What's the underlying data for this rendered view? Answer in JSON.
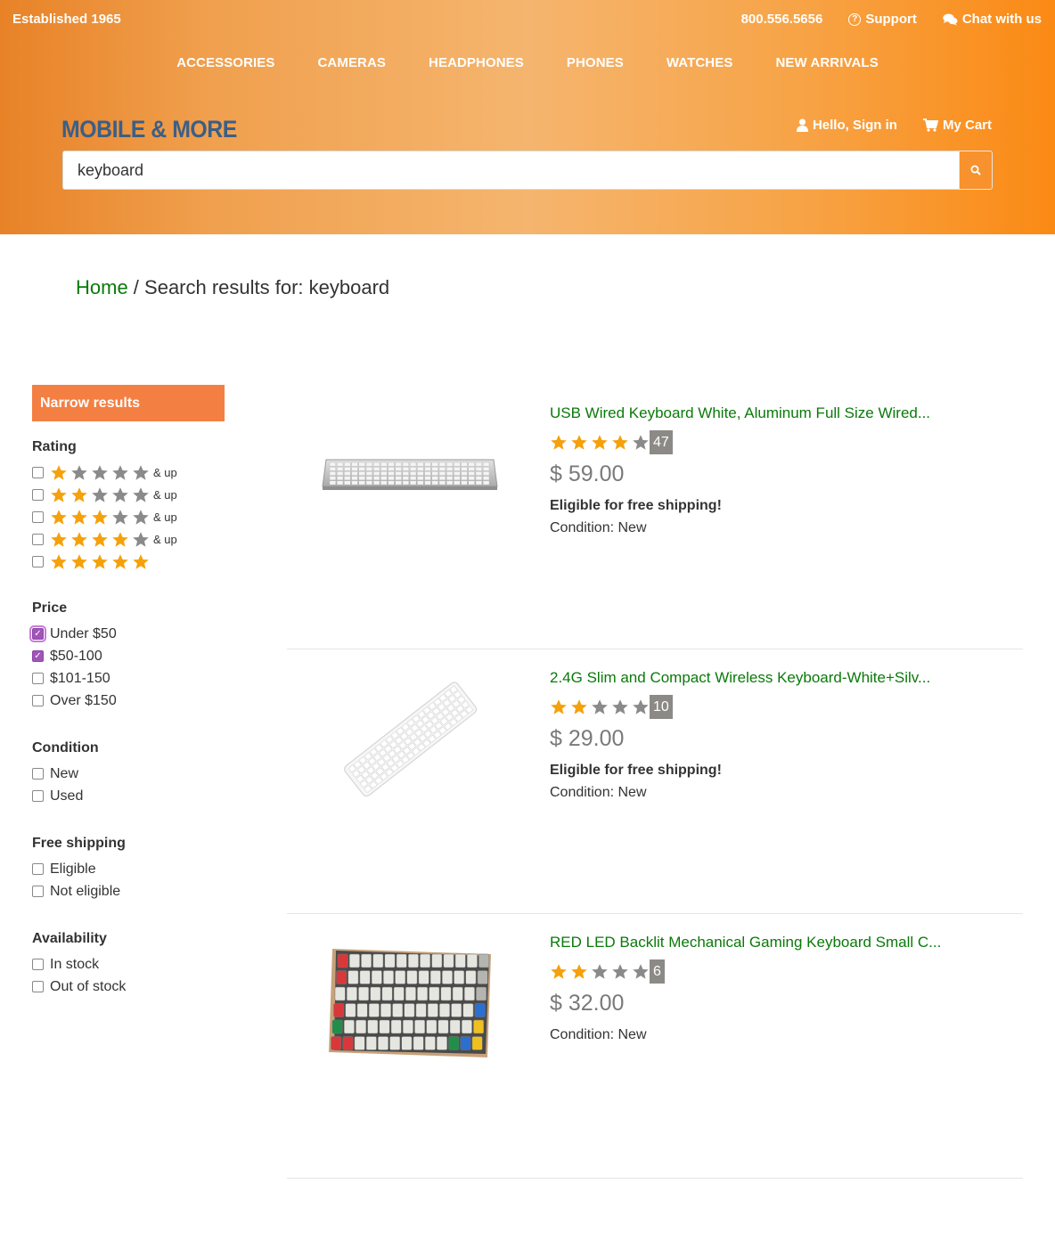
{
  "topbar": {
    "established": "Established 1965",
    "phone": "800.556.5656",
    "support": "Support",
    "chat": "Chat with us"
  },
  "nav": [
    "ACCESSORIES",
    "CAMERAS",
    "HEADPHONES",
    "PHONES",
    "WATCHES",
    "NEW ARRIVALS"
  ],
  "brand": {
    "logo": "MOBILE & MORE"
  },
  "account": {
    "signin": "Hello, Sign in",
    "cart": "My Cart"
  },
  "search": {
    "value": "keyboard"
  },
  "breadcrumb": {
    "home": "Home",
    "separator": " / ",
    "current": "Search results for: keyboard"
  },
  "sidebar": {
    "header": "Narrow results",
    "rating": {
      "title": "Rating",
      "and_up": "& up",
      "options": [
        {
          "filled": 1,
          "and_up": true,
          "checked": false
        },
        {
          "filled": 2,
          "and_up": true,
          "checked": false
        },
        {
          "filled": 3,
          "and_up": true,
          "checked": false
        },
        {
          "filled": 4,
          "and_up": true,
          "checked": false
        },
        {
          "filled": 5,
          "and_up": false,
          "checked": false
        }
      ]
    },
    "price": {
      "title": "Price",
      "options": [
        {
          "label": "Under $50",
          "checked": true
        },
        {
          "label": "$50-100",
          "checked": true
        },
        {
          "label": "$101-150",
          "checked": false
        },
        {
          "label": "Over $150",
          "checked": false
        }
      ]
    },
    "condition": {
      "title": "Condition",
      "options": [
        {
          "label": "New",
          "checked": false
        },
        {
          "label": "Used",
          "checked": false
        }
      ]
    },
    "shipping": {
      "title": "Free shipping",
      "options": [
        {
          "label": "Eligible",
          "checked": false
        },
        {
          "label": "Not eligible",
          "checked": false
        }
      ]
    },
    "availability": {
      "title": "Availability",
      "options": [
        {
          "label": "In stock",
          "checked": false
        },
        {
          "label": "Out of stock",
          "checked": false
        }
      ]
    }
  },
  "results": [
    {
      "title": "USB Wired Keyboard White, Aluminum Full Size Wired...",
      "stars": 4,
      "count": "47",
      "price": "$ 59.00",
      "shipping": "Eligible for free shipping!",
      "condition": "Condition: New",
      "image": "keyboard-silver"
    },
    {
      "title": "2.4G Slim and Compact Wireless Keyboard-White+Silv...",
      "stars": 2,
      "count": "10",
      "price": "$ 29.00",
      "shipping": "Eligible for free shipping!",
      "condition": "Condition: New",
      "image": "keyboard-white"
    },
    {
      "title": "RED LED Backlit Mechanical Gaming Keyboard Small C...",
      "stars": 2,
      "count": "6",
      "price": "$ 32.00",
      "shipping": "",
      "condition": "Condition: New",
      "image": "keyboard-mechanical"
    }
  ],
  "colors": {
    "star_filled": "#f5a10c",
    "star_empty": "#8a8a8a",
    "link_green": "#0a7a0a",
    "brand_blue": "#3b5f86",
    "narrow_bg": "#f47f42",
    "checked_purple": "#a055b8"
  }
}
